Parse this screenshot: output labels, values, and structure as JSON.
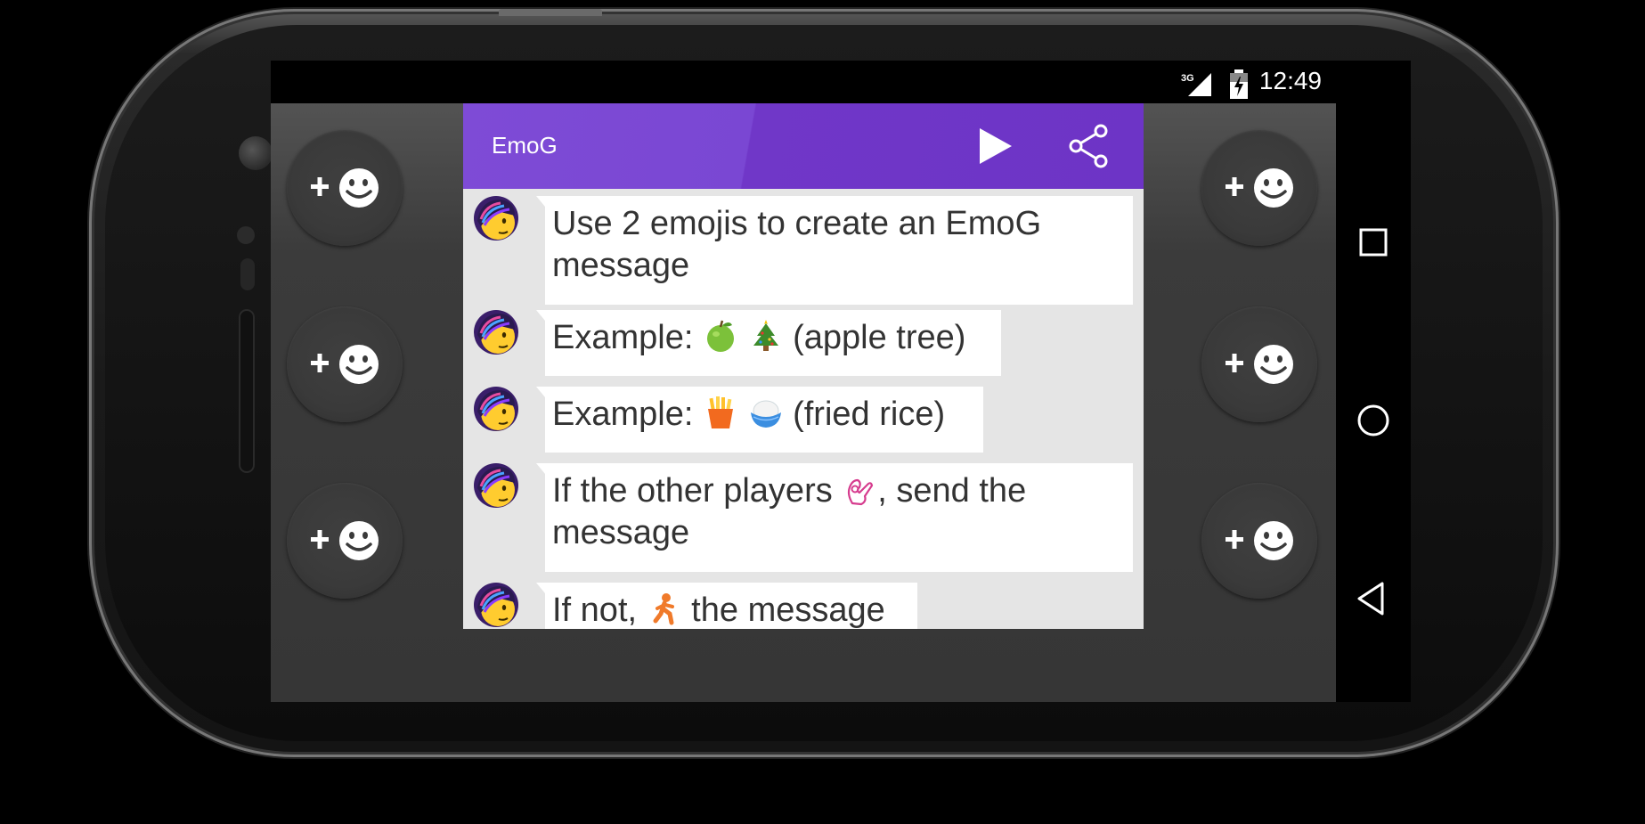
{
  "status": {
    "network": "3G",
    "time": "12:49"
  },
  "app": {
    "title": "EmoG"
  },
  "messages": [
    {
      "text": "Use 2 emojis to create an EmoG message"
    },
    {
      "prefix": "Example: ",
      "emojis": [
        "green-apple-emoji",
        "christmas-tree-emoji"
      ],
      "suffix": " (apple tree)"
    },
    {
      "prefix": "Example: ",
      "emojis": [
        "french-fries-emoji",
        "cooked-rice-emoji"
      ],
      "suffix": " (fried rice)"
    },
    {
      "prefix": "If the other players ",
      "emojis": [
        "ok-hand-emoji"
      ],
      "suffix": ", send the message"
    },
    {
      "prefix": "If not, ",
      "emojis": [
        "running-person-emoji"
      ],
      "suffix": " the message"
    }
  ],
  "side_buttons": {
    "label": "+",
    "icon": "add-emoji-icon"
  },
  "colors": {
    "appbar": "#7a47d3",
    "chat_bg": "#e5e5e5",
    "bubble": "#ffffff"
  }
}
